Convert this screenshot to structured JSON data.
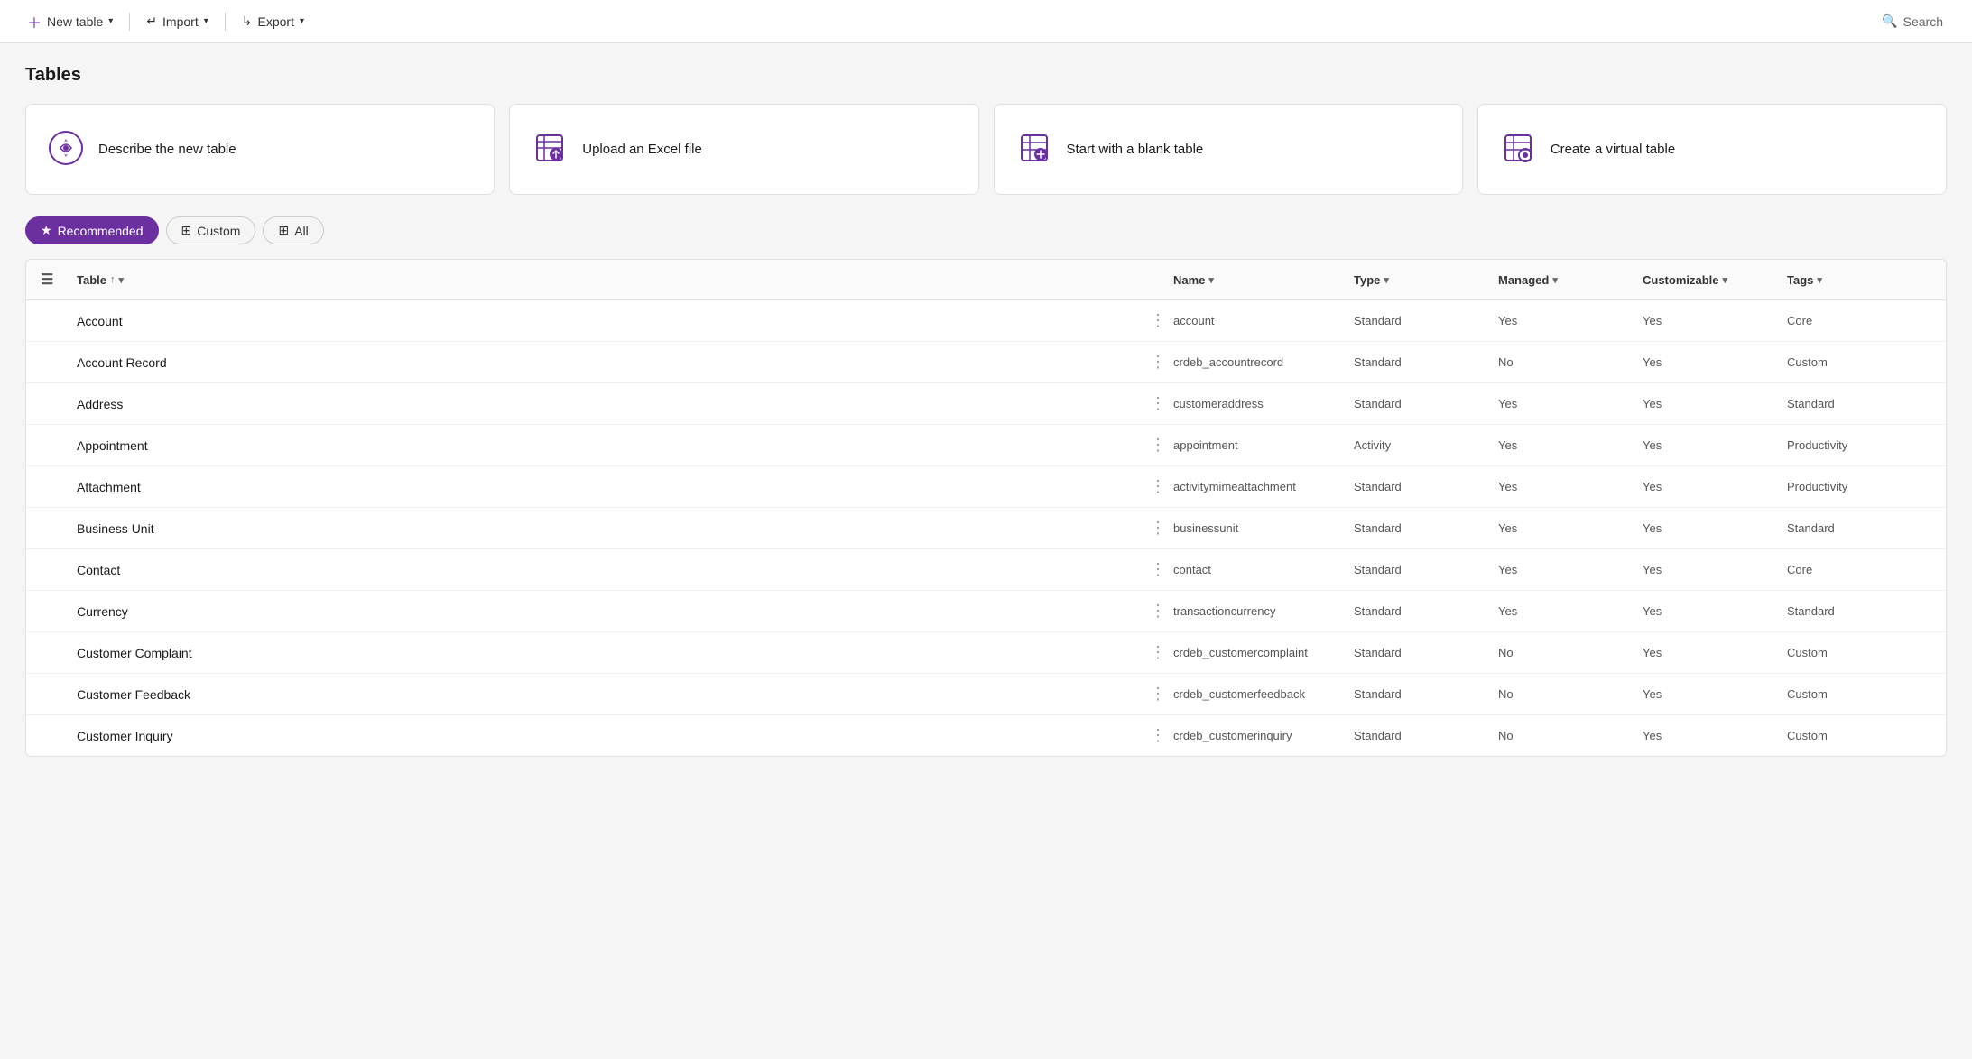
{
  "topbar": {
    "new_table_label": "New table",
    "import_label": "Import",
    "export_label": "Export",
    "search_label": "Search"
  },
  "page": {
    "title": "Tables"
  },
  "cards": [
    {
      "id": "describe",
      "label": "Describe the new table",
      "icon": "ai-icon"
    },
    {
      "id": "upload",
      "label": "Upload an Excel file",
      "icon": "excel-icon"
    },
    {
      "id": "blank",
      "label": "Start with a blank table",
      "icon": "blank-table-icon"
    },
    {
      "id": "virtual",
      "label": "Create a virtual table",
      "icon": "virtual-icon"
    }
  ],
  "filters": [
    {
      "id": "recommended",
      "label": "Recommended",
      "active": true,
      "icon": "star"
    },
    {
      "id": "custom",
      "label": "Custom",
      "active": false,
      "icon": "grid"
    },
    {
      "id": "all",
      "label": "All",
      "active": false,
      "icon": "grid"
    }
  ],
  "table": {
    "columns": [
      {
        "id": "table",
        "label": "Table",
        "sortable": true,
        "has_sort_arrow": true
      },
      {
        "id": "name",
        "label": "Name",
        "sortable": true
      },
      {
        "id": "type",
        "label": "Type",
        "sortable": true
      },
      {
        "id": "managed",
        "label": "Managed",
        "sortable": true
      },
      {
        "id": "customizable",
        "label": "Customizable",
        "sortable": true
      },
      {
        "id": "tags",
        "label": "Tags",
        "sortable": true
      }
    ],
    "rows": [
      {
        "table": "Account",
        "name": "account",
        "type": "Standard",
        "managed": "Yes",
        "customizable": "Yes",
        "tags": "Core"
      },
      {
        "table": "Account Record",
        "name": "crdeb_accountrecord",
        "type": "Standard",
        "managed": "No",
        "customizable": "Yes",
        "tags": "Custom"
      },
      {
        "table": "Address",
        "name": "customeraddress",
        "type": "Standard",
        "managed": "Yes",
        "customizable": "Yes",
        "tags": "Standard"
      },
      {
        "table": "Appointment",
        "name": "appointment",
        "type": "Activity",
        "managed": "Yes",
        "customizable": "Yes",
        "tags": "Productivity"
      },
      {
        "table": "Attachment",
        "name": "activitymimeattachment",
        "type": "Standard",
        "managed": "Yes",
        "customizable": "Yes",
        "tags": "Productivity"
      },
      {
        "table": "Business Unit",
        "name": "businessunit",
        "type": "Standard",
        "managed": "Yes",
        "customizable": "Yes",
        "tags": "Standard"
      },
      {
        "table": "Contact",
        "name": "contact",
        "type": "Standard",
        "managed": "Yes",
        "customizable": "Yes",
        "tags": "Core"
      },
      {
        "table": "Currency",
        "name": "transactioncurrency",
        "type": "Standard",
        "managed": "Yes",
        "customizable": "Yes",
        "tags": "Standard"
      },
      {
        "table": "Customer Complaint",
        "name": "crdeb_customercomplaint",
        "type": "Standard",
        "managed": "No",
        "customizable": "Yes",
        "tags": "Custom"
      },
      {
        "table": "Customer Feedback",
        "name": "crdeb_customerfeedback",
        "type": "Standard",
        "managed": "No",
        "customizable": "Yes",
        "tags": "Custom"
      },
      {
        "table": "Customer Inquiry",
        "name": "crdeb_customerinquiry",
        "type": "Standard",
        "managed": "No",
        "customizable": "Yes",
        "tags": "Custom"
      }
    ]
  }
}
